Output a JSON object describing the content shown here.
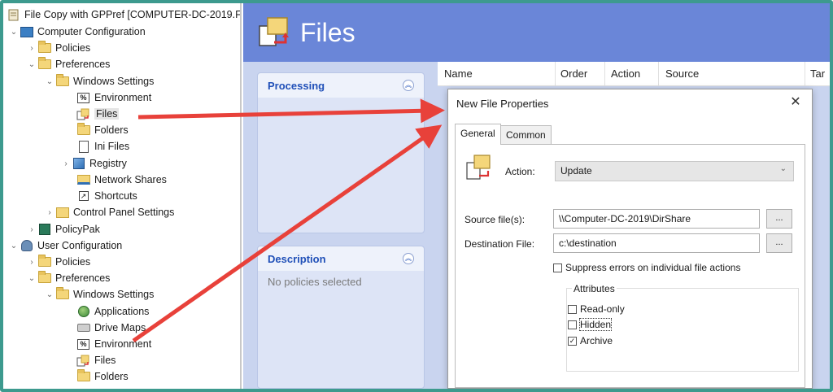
{
  "tree": {
    "root_label": "File Copy with GPPref [COMPUTER-DC-2019.F",
    "items": [
      {
        "label": "Computer Configuration",
        "icon": "computer-icon"
      },
      {
        "label": "Policies",
        "icon": "folder-icon"
      },
      {
        "label": "Preferences",
        "icon": "folder-icon"
      },
      {
        "label": "Windows Settings",
        "icon": "folder-icon"
      },
      {
        "label": "Environment",
        "icon": "environment-icon"
      },
      {
        "label": "Files",
        "icon": "files-icon"
      },
      {
        "label": "Folders",
        "icon": "folders-icon"
      },
      {
        "label": "Ini Files",
        "icon": "ini-file-icon"
      },
      {
        "label": "Registry",
        "icon": "registry-icon"
      },
      {
        "label": "Network Shares",
        "icon": "network-share-icon"
      },
      {
        "label": "Shortcuts",
        "icon": "shortcut-icon"
      },
      {
        "label": "Control Panel Settings",
        "icon": "control-panel-icon"
      },
      {
        "label": "PolicyPak",
        "icon": "policypak-icon"
      },
      {
        "label": "User Configuration",
        "icon": "user-icon"
      },
      {
        "label": "Policies",
        "icon": "folder-icon"
      },
      {
        "label": "Preferences",
        "icon": "folder-icon"
      },
      {
        "label": "Windows Settings",
        "icon": "folder-icon"
      },
      {
        "label": "Applications",
        "icon": "applications-icon"
      },
      {
        "label": "Drive Maps",
        "icon": "drive-icon"
      },
      {
        "label": "Environment",
        "icon": "environment-icon"
      },
      {
        "label": "Files",
        "icon": "files-icon"
      },
      {
        "label": "Folders",
        "icon": "folders-icon"
      }
    ]
  },
  "banner": {
    "title": "Files"
  },
  "processing_panel": {
    "title": "Processing"
  },
  "description_panel": {
    "title": "Description",
    "body": "No policies selected"
  },
  "columns": [
    "Name",
    "Order",
    "Action",
    "Source",
    "Tar"
  ],
  "dialog": {
    "title": "New File Properties",
    "close_glyph": "✕",
    "tabs": [
      "General",
      "Common"
    ],
    "action_label": "Action:",
    "action_value": "Update",
    "source_label": "Source file(s):",
    "source_value": "\\\\Computer-DC-2019\\DirShare",
    "dest_label": "Destination File:",
    "dest_value": "c:\\destination",
    "browse_label": "...",
    "suppress_label": "Suppress errors on individual file actions",
    "attributes_label": "Attributes",
    "attr_readonly": "Read-only",
    "attr_hidden": "Hidden",
    "attr_archive": "Archive",
    "archive_check": "✓"
  },
  "colors": {
    "frame": "#3d9a8e",
    "banner": "#6a86d8",
    "arrow": "#e8413a",
    "accent": "#2050b8"
  }
}
